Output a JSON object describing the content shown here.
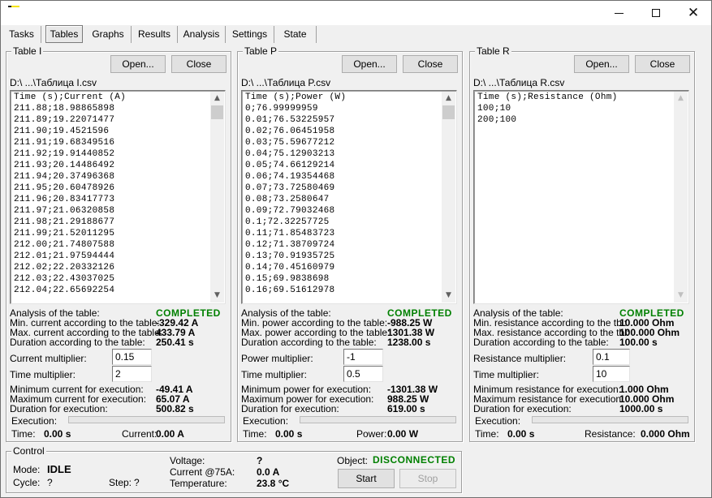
{
  "window": {
    "title": "",
    "controls": {
      "minimize": "minimize",
      "maximize": "maximize",
      "close": "close"
    }
  },
  "tabs": [
    {
      "label": "Tasks",
      "active": false
    },
    {
      "label": "Tables",
      "active": true
    },
    {
      "label": "Graphs",
      "active": false
    },
    {
      "label": "Results",
      "active": false
    },
    {
      "label": "Analysis",
      "active": false
    },
    {
      "label": "Settings",
      "active": false
    },
    {
      "label": "State",
      "active": false
    }
  ],
  "panels": {
    "current": {
      "title": "Table I",
      "open_label": "Open...",
      "close_label": "Close",
      "path": "D:\\ ...\\Таблица I.csv",
      "lines": [
        "Time (s);Current (A)",
        "211.88;18.98865898",
        "211.89;19.22071477",
        "211.90;19.4521596",
        "211.91;19.68349516",
        "211.92;19.91440852",
        "211.93;20.14486492",
        "211.94;20.37496368",
        "211.95;20.60478926",
        "211.96;20.83417773",
        "211.97;21.06320858",
        "211.98;21.29188677",
        "211.99;21.52011295",
        "212.00;21.74807588",
        "212.01;21.97594444",
        "212.02;22.20332126",
        "212.03;22.43037025",
        "212.04;22.65692254"
      ],
      "analysis_label": "Analysis of the table:",
      "analysis_status": "COMPLETED",
      "min_table_label": "Min. current according to the table:",
      "min_table_value": "-329.42 A",
      "max_table_label": "Max. current according to the table:",
      "max_table_value": "433.79 A",
      "duration_table_label": "Duration according to the table:",
      "duration_table_value": "250.41 s",
      "multiplier_label": "Current multiplier:",
      "multiplier_value": "0.15",
      "time_multiplier_label": "Time multiplier:",
      "time_multiplier_value": "2",
      "min_exec_label": "Minimum current for execution:",
      "min_exec_value": "-49.41 A",
      "max_exec_label": "Maximum current for execution:",
      "max_exec_value": "65.07 A",
      "duration_exec_label": "Duration for execution:",
      "duration_exec_value": "500.82 s",
      "execution_label": "Execution:",
      "execution_progress": 0,
      "time_label": "Time:",
      "time_value": "0.00 s",
      "quantity_label": "Current:",
      "quantity_value": "0.00 A"
    },
    "power": {
      "title": "Table P",
      "open_label": "Open...",
      "close_label": "Close",
      "path": "D:\\ ...\\Таблица P.csv",
      "lines": [
        "Time (s);Power (W)",
        "0;76.99999959",
        "0.01;76.53225957",
        "0.02;76.06451958",
        "0.03;75.59677212",
        "0.04;75.12903213",
        "0.05;74.66129214",
        "0.06;74.19354468",
        "0.07;73.72580469",
        "0.08;73.2580647",
        "0.09;72.79032468",
        "0.1;72.32257725",
        "0.11;71.85483723",
        "0.12;71.38709724",
        "0.13;70.91935725",
        "0.14;70.45160979",
        "0.15;69.9838698",
        "0.16;69.51612978"
      ],
      "analysis_label": "Analysis of the table:",
      "analysis_status": "COMPLETED",
      "min_table_label": "Min. power according to the table:",
      "min_table_value": "-988.25 W",
      "max_table_label": "Max. power according to the table:",
      "max_table_value": "1301.38 W",
      "duration_table_label": "Duration according to the table:",
      "duration_table_value": "1238.00 s",
      "multiplier_label": "Power multiplier:",
      "multiplier_value": "-1",
      "time_multiplier_label": "Time multiplier:",
      "time_multiplier_value": "0.5",
      "min_exec_label": "Minimum power for execution:",
      "min_exec_value": "-1301.38 W",
      "max_exec_label": "Maximum power for execution:",
      "max_exec_value": "988.25 W",
      "duration_exec_label": "Duration for execution:",
      "duration_exec_value": "619.00 s",
      "execution_label": "Execution:",
      "execution_progress": 0,
      "time_label": "Time:",
      "time_value": "0.00 s",
      "quantity_label": "Power:",
      "quantity_value": "0.00 W"
    },
    "resistance": {
      "title": "Table R",
      "open_label": "Open...",
      "close_label": "Close",
      "path": "D:\\ ...\\Таблица R.csv",
      "lines": [
        "Time (s);Resistance (Ohm)",
        "100;10",
        "200;100"
      ],
      "analysis_label": "Analysis of the table:",
      "analysis_status": "COMPLETED",
      "min_table_label": "Min. resistance according to the tbl:",
      "min_table_value": "10.000 Ohm",
      "max_table_label": "Max. resistance according to the tbl:",
      "max_table_value": "100.000 Ohm",
      "duration_table_label": "Duration according to the table:",
      "duration_table_value": "100.00 s",
      "multiplier_label": "Resistance multiplier:",
      "multiplier_value": "0.1",
      "time_multiplier_label": "Time multiplier:",
      "time_multiplier_value": "10",
      "min_exec_label": "Minimum resistance for execution:",
      "min_exec_value": "1.000 Ohm",
      "max_exec_label": "Maximum resistance for execution:",
      "max_exec_value": "10.000 Ohm",
      "duration_exec_label": "Duration for execution:",
      "duration_exec_value": "1000.00 s",
      "execution_label": "Execution:",
      "execution_progress": 0,
      "time_label": "Time:",
      "time_value": "0.00 s",
      "quantity_label": "Resistance:",
      "quantity_value": "0.000 Ohm"
    }
  },
  "control": {
    "title": "Control",
    "mode_label": "Mode:",
    "mode_value": "IDLE",
    "cycle_label": "Cycle:",
    "cycle_value": "?",
    "step_label": "Step:",
    "step_value": "?",
    "voltage_label": "Voltage:",
    "voltage_value": "?",
    "current_label": "Current @75A:",
    "current_value": "0.0 A",
    "temperature_label": "Temperature:",
    "temperature_value": "23.8 °C",
    "object_label": "Object:",
    "object_status": "DISCONNECTED",
    "start_label": "Start",
    "stop_label": "Stop"
  },
  "colors": {
    "status_ok": "#008000"
  }
}
